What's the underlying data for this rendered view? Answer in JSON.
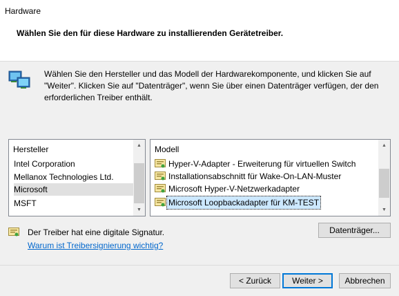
{
  "window": {
    "title": "Hardware"
  },
  "header": {
    "title": "Wählen Sie den für diese Hardware zu installierenden Gerätetreiber."
  },
  "description": {
    "line1": "Wählen Sie den Hersteller und das Modell der Hardwarekomponente, und klicken Sie auf",
    "line2": "\"Weiter\". Klicken Sie auf \"Datenträger\", wenn Sie über einen Datenträger verfügen, der den",
    "line3": "erforderlichen Treiber enthält."
  },
  "manufacturer": {
    "header": "Hersteller",
    "items": [
      "Intel Corporation",
      "Mellanox Technologies Ltd.",
      "Microsoft",
      "MSFT"
    ],
    "selected": "Microsoft"
  },
  "model": {
    "header": "Modell",
    "items": [
      "Hyper-V-Adapter - Erweiterung für virtuellen Switch",
      "Installationsabschnitt für Wake-On-LAN-Muster",
      "Microsoft Hyper-V-Netzwerkadapter",
      "Microsoft Loopbackadapter für KM-TEST"
    ],
    "selected": "Microsoft Loopbackadapter für KM-TEST"
  },
  "signature": {
    "text": "Der Treiber hat eine digitale Signatur.",
    "link": "Warum ist Treibersignierung wichtig?"
  },
  "buttons": {
    "disk": "Datenträger...",
    "back": "< Zurück",
    "next": "Weiter >",
    "cancel": "Abbrechen"
  }
}
